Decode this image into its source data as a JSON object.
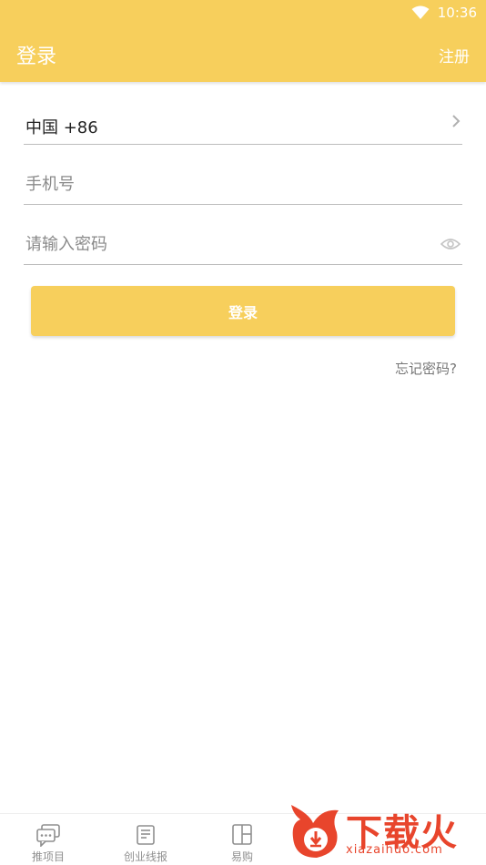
{
  "status_bar": {
    "time": "10:36",
    "wifi_icon": "wifi-icon"
  },
  "app_bar": {
    "title": "登录",
    "register": "注册"
  },
  "form": {
    "country": {
      "label": "中国 +86",
      "icon": "chevron-right-icon"
    },
    "phone": {
      "placeholder": "手机号"
    },
    "password": {
      "placeholder": "请输入密码",
      "icon": "eye-icon"
    },
    "login_button": "登录",
    "forgot_password": "忘记密码?"
  },
  "bottom_nav": {
    "items": [
      {
        "label": "推项目",
        "icon": "chat-bubbles-icon"
      },
      {
        "label": "创业线报",
        "icon": "news-icon"
      },
      {
        "label": "易购",
        "icon": "grid-icon"
      }
    ]
  },
  "watermark": {
    "brand": "下载火",
    "site": "xiazaihuo.com",
    "icon": "flame-download-logo"
  },
  "colors": {
    "accent": "#f7cf5c",
    "watermark": "#e8452c"
  }
}
